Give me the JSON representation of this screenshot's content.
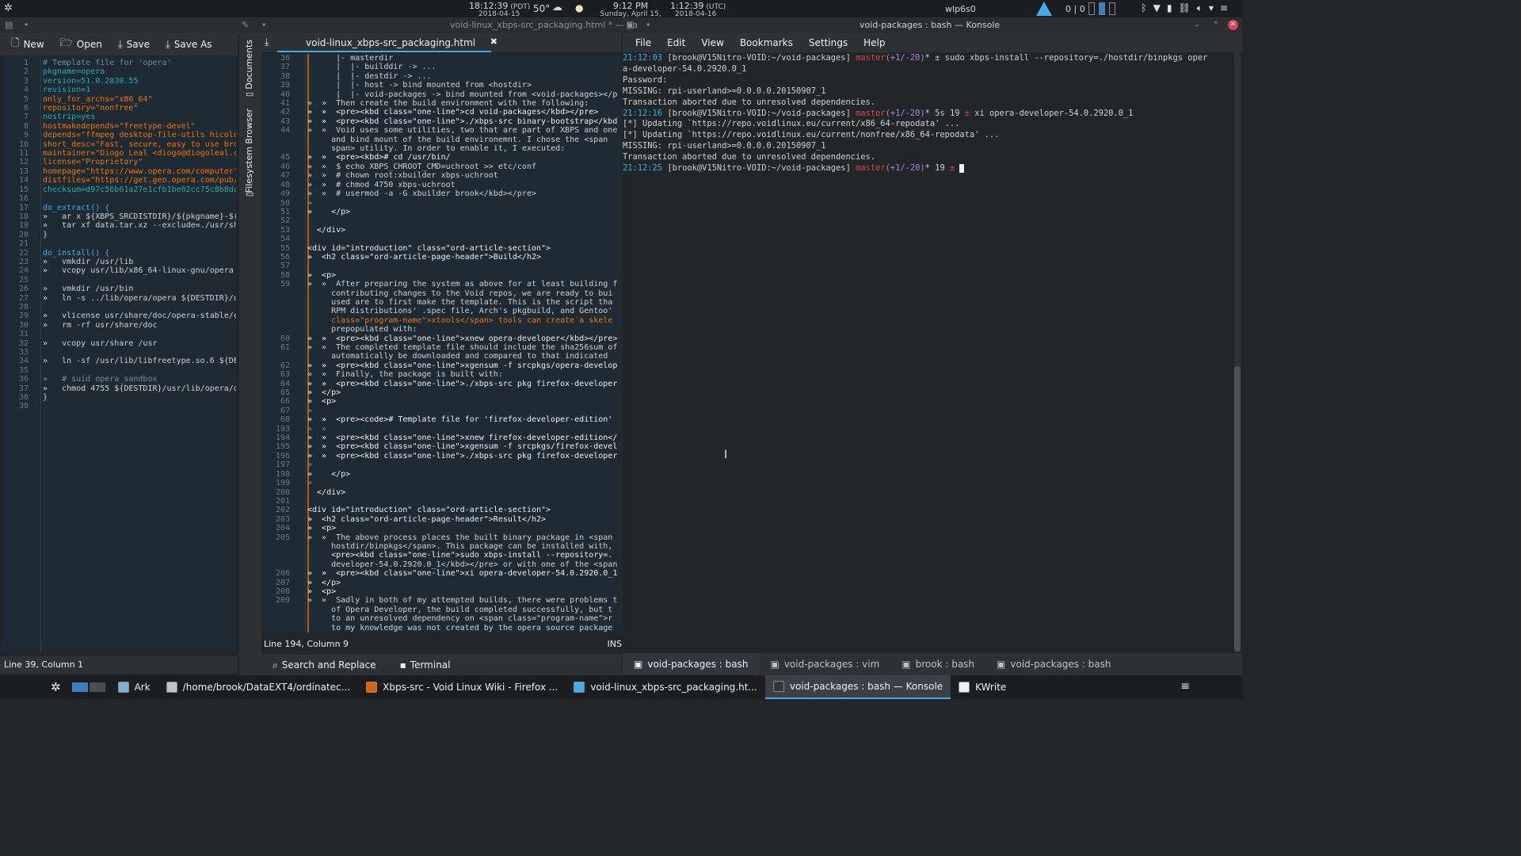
{
  "top_panel": {
    "menu_icon": "kde-icon",
    "pdt_time": "18:12:39",
    "pdt_tz": "(PDT)",
    "pdt_date": "2018-04-15",
    "weather_temp": "50°",
    "weather_icon": "cloud-rain-icon",
    "moon_icon": "moon-icon",
    "local_time": "9:12 PM",
    "local_date": "Sunday, April 15, 2018",
    "utc_time": "1:12:39",
    "utc_tz": "(UTC)",
    "utc_date": "2018-04-16",
    "network_name": "wlp6s0",
    "counter": "0 | 0"
  },
  "title_strip": {
    "kate_title": "void-linux_xbps-src_packaging.html * — Ka",
    "konsole_title": "void-packages : bash — Konsole"
  },
  "left_kate": {
    "toolbar": {
      "new": "New",
      "open": "Open",
      "save": "Save",
      "save_as": "Save As"
    },
    "status": "Line 39, Column 1",
    "lines": [
      {
        "n": "1",
        "t": "# Template file for 'opera'",
        "c": "c-com"
      },
      {
        "n": "2",
        "t": "pkgname=opera",
        "c": "c-key"
      },
      {
        "n": "3",
        "t": "version=51.0.2830.55",
        "c": "c-key"
      },
      {
        "n": "4",
        "t": "revision=1",
        "c": "c-key"
      },
      {
        "n": "5",
        "t": "only_for_archs=\"x86_64\"",
        "c": "c-str"
      },
      {
        "n": "6",
        "t": "repository=\"nonfree\"",
        "c": "c-str"
      },
      {
        "n": "7",
        "t": "nostrip=yes",
        "c": "c-key"
      },
      {
        "n": "8",
        "t": "hostmakedepends=\"freetype-devel\"",
        "c": "c-str"
      },
      {
        "n": "9",
        "t": "depends=\"ffmpeg desktop-file-utils hicolor",
        "c": "c-str"
      },
      {
        "n": "10",
        "t": "short_desc=\"Fast, secure, easy to use brow",
        "c": "c-str"
      },
      {
        "n": "11",
        "t": "maintainer=\"Diogo Leal <diogo@diogoleal.co",
        "c": "c-str"
      },
      {
        "n": "12",
        "t": "license=\"Proprietary\"",
        "c": "c-str"
      },
      {
        "n": "13",
        "t": "homepage=\"https://www.opera.com/computer\"",
        "c": "c-str"
      },
      {
        "n": "14",
        "t": "distfiles=\"https://get.geo.opera.com/pub/o",
        "c": "c-str"
      },
      {
        "n": "15",
        "t": "checksum=d97c56b61a27e1cfb1be02cc75c8b8da7",
        "c": "c-key"
      },
      {
        "n": "16",
        "t": "",
        "c": "c-txt"
      },
      {
        "n": "17",
        "t": "do_extract() {",
        "c": "c-blue"
      },
      {
        "n": "18",
        "t": "»   ar x ${XBPS_SRCDISTDIR}/${pkgname}-${v",
        "c": "c-txt"
      },
      {
        "n": "19",
        "t": "»   tar xf data.tar.xz --exclude=./usr/sha",
        "c": "c-txt"
      },
      {
        "n": "20",
        "t": "}",
        "c": "c-txt"
      },
      {
        "n": "21",
        "t": "",
        "c": "c-txt"
      },
      {
        "n": "22",
        "t": "do_install() {",
        "c": "c-blue"
      },
      {
        "n": "23",
        "t": "»   vmkdir /usr/lib",
        "c": "c-txt"
      },
      {
        "n": "24",
        "t": "»   vcopy usr/lib/x86_64-linux-gnu/opera /",
        "c": "c-txt"
      },
      {
        "n": "25",
        "t": "",
        "c": "c-txt"
      },
      {
        "n": "26",
        "t": "»   vmkdir /usr/bin",
        "c": "c-txt"
      },
      {
        "n": "27",
        "t": "»   ln -s ../lib/opera/opera ${DESTDIR}/us",
        "c": "c-txt"
      },
      {
        "n": "28",
        "t": "",
        "c": "c-txt"
      },
      {
        "n": "29",
        "t": "»   vlicense usr/share/doc/opera-stable/co",
        "c": "c-txt"
      },
      {
        "n": "30",
        "t": "»   rm -rf usr/share/doc",
        "c": "c-txt"
      },
      {
        "n": "31",
        "t": "",
        "c": "c-txt"
      },
      {
        "n": "32",
        "t": "»   vcopy usr/share /usr",
        "c": "c-txt"
      },
      {
        "n": "33",
        "t": "",
        "c": "c-txt"
      },
      {
        "n": "34",
        "t": "»   ln -sf /usr/lib/libfreetype.so.6 ${DES",
        "c": "c-txt"
      },
      {
        "n": "35",
        "t": "",
        "c": "c-txt"
      },
      {
        "n": "36",
        "t": "»   # suid opera_sandbox",
        "c": "c-com"
      },
      {
        "n": "37",
        "t": "»   chmod 4755 ${DESTDIR}/usr/lib/opera/op",
        "c": "c-txt"
      },
      {
        "n": "38",
        "t": "}",
        "c": "c-txt"
      },
      {
        "n": "39",
        "t": "",
        "c": "c-txt"
      }
    ]
  },
  "side_tabs": {
    "documents": "Documents",
    "filesystem": "Filesystem Browser"
  },
  "mid_kate": {
    "tab_label": "void-linux_xbps-src_packaging.html",
    "status": "Line 194, Column 9",
    "ins": "INS",
    "search_replace": "Search and Replace",
    "terminal": "Terminal",
    "lines": [
      {
        "n": "36",
        "t": "      |- masterdir",
        "c": "c-txt"
      },
      {
        "n": "37",
        "t": "      |  |- builddir -> ...",
        "c": "c-txt"
      },
      {
        "n": "38",
        "t": "      |  |- destdir -> ...",
        "c": "c-txt"
      },
      {
        "n": "39",
        "t": "      |  |- host -> bind mounted from <hostdir>",
        "c": "c-txt"
      },
      {
        "n": "40",
        "t": "      |  |- void-packages -> bind mounted from <void-packages></p",
        "c": "c-txt"
      },
      {
        "n": "41",
        "t": "»  »  Then create the build environment with the following:",
        "c": "c-txt"
      },
      {
        "n": "42",
        "t": "»  »  <pre><kbd class=\"one-line\">cd void-packages</kbd></pre>",
        "c": "c-tag"
      },
      {
        "n": "43",
        "t": "»  »  <pre><kbd class=\"one-line\">./xbps-src binary-bootstrap</kbd",
        "c": "c-tag"
      },
      {
        "n": "44",
        "t": "»  »  Void uses some utilities, two that are part of XBPS and one",
        "c": "c-txt"
      },
      {
        "n": "",
        "t": "     and bind mount of the build environemnt. I chose the <span",
        "c": "c-txt"
      },
      {
        "n": "",
        "t": "     span> utility. In order to enable it, I executed:",
        "c": "c-txt"
      },
      {
        "n": "45",
        "t": "»  »  <pre><kbd># cd /usr/bin/",
        "c": "c-tag"
      },
      {
        "n": "46",
        "t": "»  »  $ echo XBPS_CHROOT_CMD=uchroot >> etc/conf",
        "c": "c-txt"
      },
      {
        "n": "47",
        "t": "»  »  # chown root:xbuilder xbps-uchroot",
        "c": "c-txt"
      },
      {
        "n": "48",
        "t": "»  »  # chmod 4750 xbps-uchroot",
        "c": "c-txt"
      },
      {
        "n": "49",
        "t": "»  »  # usermod -a -G xbuilder brook</kbd></pre>",
        "c": "c-txt"
      },
      {
        "n": "50",
        "t": "»",
        "c": "c-dim"
      },
      {
        "n": "51",
        "t": "»    </p>",
        "c": "c-tag"
      },
      {
        "n": "52",
        "t": "",
        "c": "c-txt"
      },
      {
        "n": "53",
        "t": "  </div>",
        "c": "c-tag"
      },
      {
        "n": "54",
        "t": "",
        "c": "c-txt"
      },
      {
        "n": "55",
        "t": "<div id=\"introduction\" class=\"ord-article-section\">",
        "c": "c-tag"
      },
      {
        "n": "56",
        "t": "»  <h2 class=\"ord-article-page-header\">Build</h2>",
        "c": "c-tag"
      },
      {
        "n": "57",
        "t": "",
        "c": "c-txt"
      },
      {
        "n": "58",
        "t": "»  <p>",
        "c": "c-tag"
      },
      {
        "n": "59",
        "t": "»  »  After preparing the system as above for at least building f",
        "c": "c-txt"
      },
      {
        "n": "",
        "t": "     contributing changes to the Void repos, we are ready to bui",
        "c": "c-txt"
      },
      {
        "n": "",
        "t": "     used are to first make the template. This is the script tha",
        "c": "c-txt"
      },
      {
        "n": "",
        "t": "     RPM distributions' .spec file, Arch's pkgbuild, and Gentoo'",
        "c": "c-txt"
      },
      {
        "n": "",
        "t": "     class=\"program-name\">xtools</span> tools can create a skele",
        "c": "c-str"
      },
      {
        "n": "",
        "t": "     prepopulated with:",
        "c": "c-txt"
      },
      {
        "n": "60",
        "t": "»  »  <pre><kbd class=\"one-line\">xnew opera-developer</kbd></pre>",
        "c": "c-tag"
      },
      {
        "n": "61",
        "t": "»  »  The completed template file should include the sha256sum of",
        "c": "c-txt"
      },
      {
        "n": "",
        "t": "     automatically be downloaded and compared to that indicated",
        "c": "c-txt"
      },
      {
        "n": "62",
        "t": "»  »  <pre><kbd class=\"one-line\">xgensum -f srcpkgs/opera-develop",
        "c": "c-tag"
      },
      {
        "n": "63",
        "t": "»  »  Finally, the package is built with:",
        "c": "c-txt"
      },
      {
        "n": "64",
        "t": "»  »  <pre><kbd class=\"one-line\">./xbps-src pkg firefox-developer",
        "c": "c-tag"
      },
      {
        "n": "65",
        "t": "»  </p>",
        "c": "c-tag"
      },
      {
        "n": "66",
        "t": "»  <p>",
        "c": "c-tag"
      },
      {
        "n": "67",
        "t": "»",
        "c": "c-dim"
      },
      {
        "n": "68",
        "t": "»  »  <pre><code># Template file for 'firefox-developer-edition'",
        "c": "c-tag"
      },
      {
        "n": "193",
        "t": "»  »",
        "c": "c-dim"
      },
      {
        "n": "194",
        "t": "»  »  <pre><kbd class=\"one-line\">xnew firefox-developer-edition</",
        "c": "c-tag"
      },
      {
        "n": "195",
        "t": "»  »  <pre><kbd class=\"one-line\">xgensum -f srcpkgs/firefox-devel",
        "c": "c-tag"
      },
      {
        "n": "196",
        "t": "»  »  <pre><kbd class=\"one-line\">./xbps-src pkg firefox-developer",
        "c": "c-tag"
      },
      {
        "n": "197",
        "t": "»",
        "c": "c-dim"
      },
      {
        "n": "198",
        "t": "»    </p>",
        "c": "c-tag"
      },
      {
        "n": "199",
        "t": "»",
        "c": "c-dim"
      },
      {
        "n": "200",
        "t": "  </div>",
        "c": "c-tag"
      },
      {
        "n": "201",
        "t": "",
        "c": "c-txt"
      },
      {
        "n": "202",
        "t": "<div id=\"introduction\" class=\"ord-article-section\">",
        "c": "c-tag"
      },
      {
        "n": "203",
        "t": "»  <h2 class=\"ord-article-page-header\">Result</h2>",
        "c": "c-tag"
      },
      {
        "n": "204",
        "t": "»  <p>",
        "c": "c-tag"
      },
      {
        "n": "205",
        "t": "»  »  The above process places the built binary package in <span",
        "c": "c-txt"
      },
      {
        "n": "",
        "t": "     hostdir/binpkgs</span>. This package can be installed with,",
        "c": "c-txt"
      },
      {
        "n": "",
        "t": "     <pre><kbd class=\"one-line\">sudo xbps-install --repository=.",
        "c": "c-tag"
      },
      {
        "n": "",
        "t": "     developer-54.0.2920.0_1</kbd></pre> or with one of the <span",
        "c": "c-txt"
      },
      {
        "n": "206",
        "t": "»  »  <pre><kbd class=\"one-line\">xi opera-developer-54.0.2920.0_1",
        "c": "c-tag"
      },
      {
        "n": "207",
        "t": "»  </p>",
        "c": "c-tag"
      },
      {
        "n": "208",
        "t": "»  <p>",
        "c": "c-tag"
      },
      {
        "n": "209",
        "t": "»  »  Sadly in both of my attempted builds, there were problems t",
        "c": "c-txt"
      },
      {
        "n": "",
        "t": "     of Opera Developer, the build completed successfully, but t",
        "c": "c-txt"
      },
      {
        "n": "",
        "t": "     to an unresolved dependency on <span class=\"program-name\">r",
        "c": "c-txt"
      },
      {
        "n": "",
        "t": "     to my knowledge was not created by the opera source package",
        "c": "c-txt"
      }
    ]
  },
  "konsole": {
    "menu": [
      "File",
      "Edit",
      "View",
      "Bookmarks",
      "Settings",
      "Help"
    ],
    "lines": [
      [
        {
          "t": "21:12:03 ",
          "c": "c-blue"
        },
        {
          "t": "[brook",
          "c": "c-txt"
        },
        {
          "t": "@",
          "c": "c-txt"
        },
        {
          "t": "V15Nitro-VOID",
          "c": "c-txt"
        },
        {
          "t": ":",
          "c": "c-txt"
        },
        {
          "t": "~/void-packages",
          "c": "c-txt"
        },
        {
          "t": "] ",
          "c": "c-txt"
        },
        {
          "t": "master",
          "c": "c-red"
        },
        {
          "t": "(+1/-20)",
          "c": "c-purp"
        },
        {
          "t": "* ± sudo xbps-install --repository=./hostdir/binpkgs oper",
          "c": "c-txt"
        }
      ],
      [
        {
          "t": "a-developer-54.0.2920.0_1",
          "c": "c-txt"
        }
      ],
      [
        {
          "t": "Password:",
          "c": "c-txt"
        }
      ],
      [
        {
          "t": "MISSING: rpi-userland>=0.0.0.0.20150907_1",
          "c": "c-txt"
        }
      ],
      [
        {
          "t": "Transaction aborted due to unresolved dependencies.",
          "c": "c-txt"
        }
      ],
      [
        {
          "t": "21:12:16 ",
          "c": "c-blue"
        },
        {
          "t": "[brook",
          "c": "c-txt"
        },
        {
          "t": "@",
          "c": "c-txt"
        },
        {
          "t": "V15Nitro-VOID",
          "c": "c-txt"
        },
        {
          "t": ":",
          "c": "c-txt"
        },
        {
          "t": "~/void-packages",
          "c": "c-txt"
        },
        {
          "t": "] ",
          "c": "c-txt"
        },
        {
          "t": "master",
          "c": "c-red"
        },
        {
          "t": "(+1/-20)",
          "c": "c-purp"
        },
        {
          "t": "* 5s 19 ",
          "c": "c-txt"
        },
        {
          "t": "±",
          "c": "c-red"
        },
        {
          "t": " xi opera-developer-54.0.2920.0_1",
          "c": "c-txt"
        }
      ],
      [
        {
          "t": "[*] Updating `https://repo.voidlinux.eu/current/x86_64-repodata' ...",
          "c": "c-txt"
        }
      ],
      [
        {
          "t": "[*] Updating `https://repo.voidlinux.eu/current/nonfree/x86_64-repodata' ...",
          "c": "c-txt"
        }
      ],
      [
        {
          "t": "MISSING: rpi-userland>=0.0.0.0.20150907_1",
          "c": "c-txt"
        }
      ],
      [
        {
          "t": "Transaction aborted due to unresolved dependencies.",
          "c": "c-txt"
        }
      ],
      [
        {
          "t": "21:12:25 ",
          "c": "c-blue"
        },
        {
          "t": "[brook",
          "c": "c-txt"
        },
        {
          "t": "@",
          "c": "c-txt"
        },
        {
          "t": "V15Nitro-VOID",
          "c": "c-txt"
        },
        {
          "t": ":",
          "c": "c-txt"
        },
        {
          "t": "~/void-packages",
          "c": "c-txt"
        },
        {
          "t": "] ",
          "c": "c-txt"
        },
        {
          "t": "master",
          "c": "c-red"
        },
        {
          "t": "(+1/-20)",
          "c": "c-purp"
        },
        {
          "t": "* 19 ",
          "c": "c-txt"
        },
        {
          "t": "±",
          "c": "c-red"
        },
        {
          "t": " ",
          "c": "c-txt"
        }
      ]
    ],
    "tabs": [
      "void-packages : bash",
      "void-packages : vim",
      "brook : bash",
      "void-packages : bash"
    ]
  },
  "taskbar": {
    "items": [
      {
        "label": "Ark",
        "icon": "ark-icon"
      },
      {
        "label": "/home/brook/DataEXT4/ordinatec...",
        "icon": "folder-icon"
      },
      {
        "label": "Xbps-src - Void Linux Wiki - Firefox ...",
        "icon": "firefox-icon"
      },
      {
        "label": "void-linux_xbps-src_packaging.ht...",
        "icon": "kate-icon"
      },
      {
        "label": "void-packages : bash — Konsole",
        "icon": "konsole-icon"
      },
      {
        "label": "KWrite",
        "icon": "kwrite-icon"
      }
    ]
  },
  "colors": {
    "accent": "#3daee9",
    "editor_bg": "#1e2a34",
    "panel_bg": "#1b1d20"
  }
}
